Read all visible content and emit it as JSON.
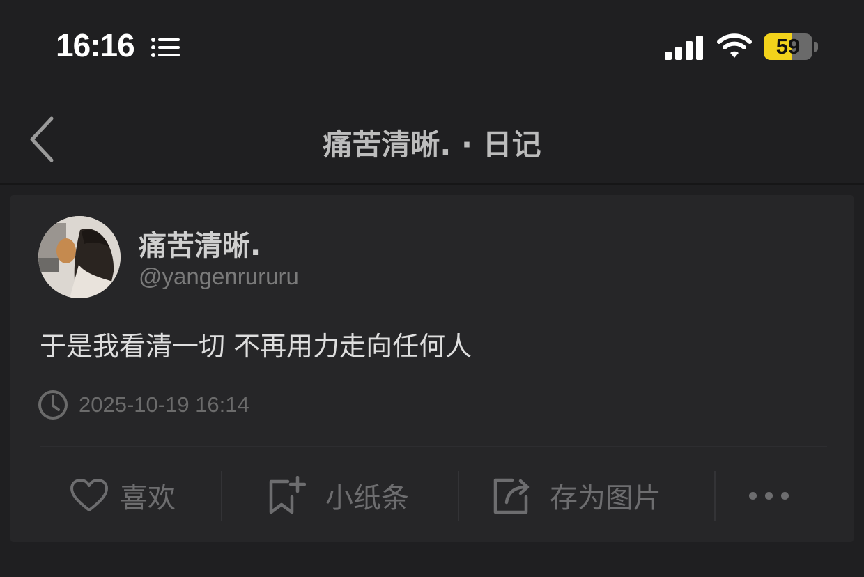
{
  "status_bar": {
    "time": "16:16",
    "battery_level": "59",
    "battery_fraction": 0.59,
    "icons": [
      "list-icon",
      "signal-icon",
      "wifi-icon",
      "battery-icon"
    ],
    "battery_color": "#f2d21b"
  },
  "nav": {
    "title": "痛苦清晰. · 日记",
    "back_icon": "chevron-left-icon"
  },
  "post": {
    "author_name": "痛苦清晰.",
    "author_handle": "@yangenrururu",
    "text": "于是我看清一切 不再用力走向任何人",
    "timestamp": "2025-10-19 16:14",
    "clock_icon": "clock-icon"
  },
  "actions": {
    "like_label": "喜欢",
    "note_label": "小纸条",
    "save_image_label": "存为图片",
    "like_icon": "heart-icon",
    "note_icon": "bookmark-plus-icon",
    "save_icon": "share-export-icon",
    "more_icon": "more-dots-icon"
  }
}
